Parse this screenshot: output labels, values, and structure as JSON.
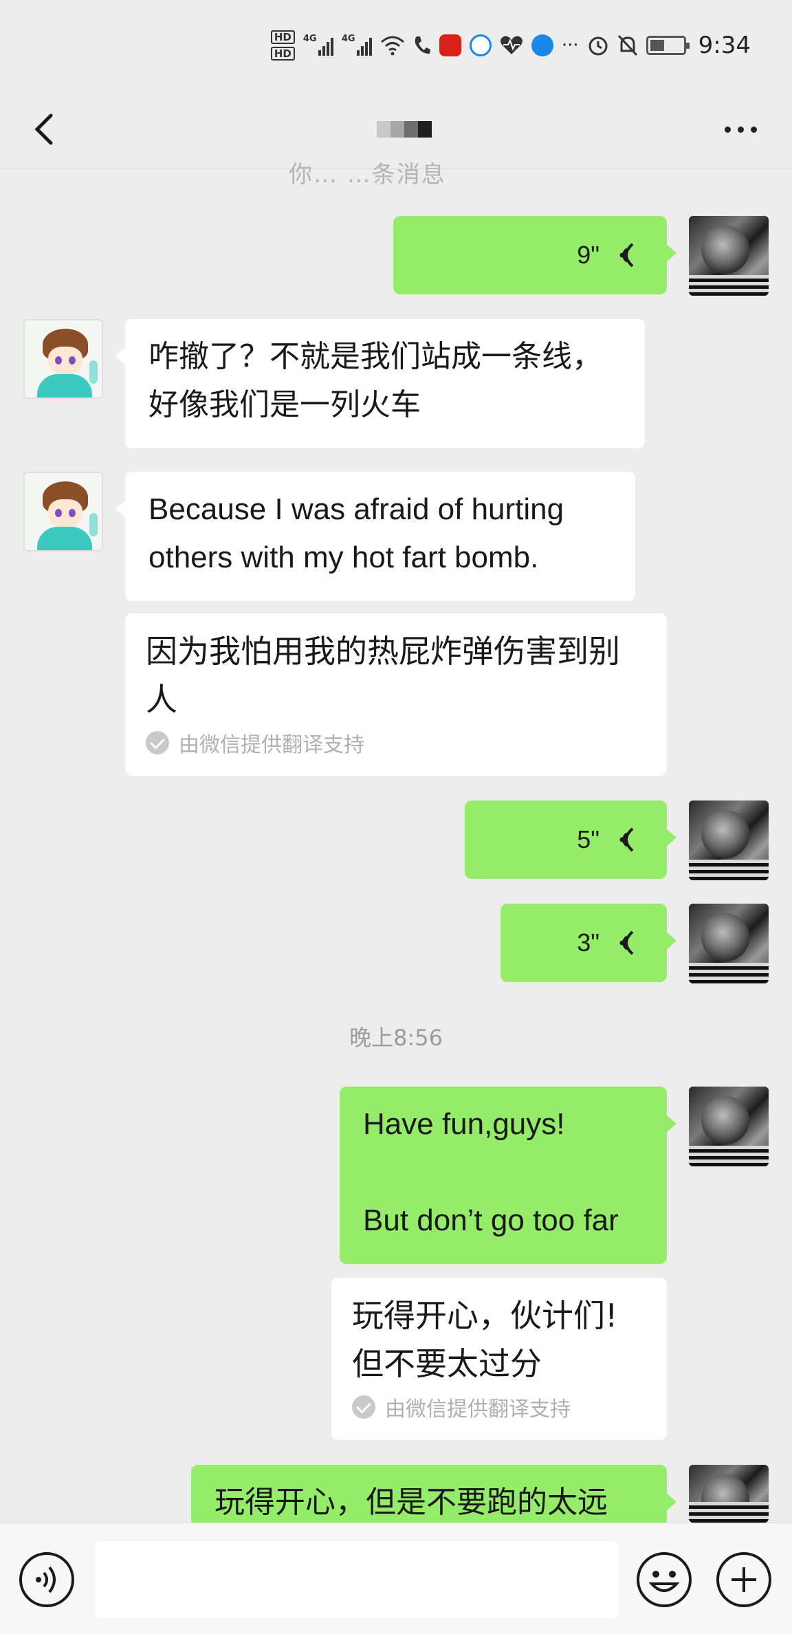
{
  "status_bar": {
    "hd1": "HD",
    "hd2": "HD",
    "net1": "4G",
    "net2": "4G",
    "more": "···",
    "time": "9:34"
  },
  "header": {
    "back_icon": "chevron-left-icon",
    "more_icon": "more-dots-icon",
    "peek_text": "你…    …条消息"
  },
  "messages": [
    {
      "type": "voice",
      "side": "right",
      "duration": "9\""
    },
    {
      "type": "text",
      "side": "left",
      "lines": [
        "咋撤了？不就是我们站成一条线，",
        "好像我们是一列火车"
      ]
    },
    {
      "type": "text",
      "side": "left",
      "lines": [
        "Because I was afraid of hurting",
        "others with my hot fart bomb."
      ]
    },
    {
      "type": "translation",
      "side": "left",
      "lines": [
        "因为我怕用我的热屁炸弹伤害到别",
        "人"
      ],
      "credit": "由微信提供翻译支持"
    },
    {
      "type": "voice",
      "side": "right",
      "duration": "5\""
    },
    {
      "type": "voice",
      "side": "right",
      "duration": "3\""
    },
    {
      "type": "time",
      "text": "晚上8:56"
    },
    {
      "type": "text",
      "side": "right",
      "lines": [
        "Have fun,guys!",
        "",
        "But don’t go too far"
      ]
    },
    {
      "type": "translation",
      "side": "right",
      "lines": [
        "玩得开心，伙计们!",
        "但不要太过分"
      ],
      "credit": "由微信提供翻译支持"
    },
    {
      "type": "text",
      "side": "right",
      "lines": [
        "玩得开心，但是不要跑的太远"
      ]
    }
  ],
  "input_bar": {
    "voice_icon": "voice-input-icon",
    "emoji_icon": "emoji-icon",
    "plus_icon": "plus-icon",
    "input_value": ""
  },
  "colors": {
    "background": "#ededed",
    "sent_bubble": "#95ec69",
    "received_bubble": "#ffffff"
  }
}
